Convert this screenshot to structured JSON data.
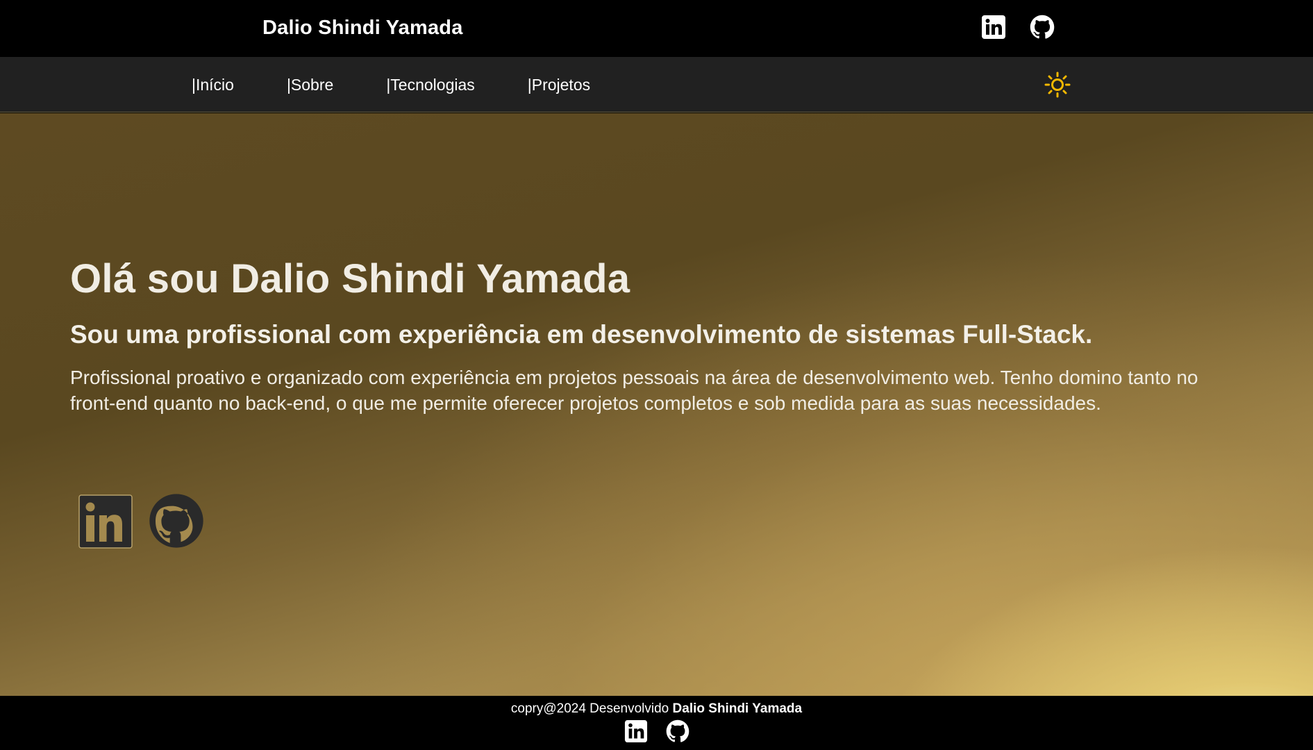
{
  "header": {
    "brand": "Dalio Shindi Yamada",
    "icons": [
      "linkedin-icon",
      "github-icon"
    ]
  },
  "nav": {
    "items": [
      {
        "label": "|Início"
      },
      {
        "label": "|Sobre"
      },
      {
        "label": "|Tecnologias"
      },
      {
        "label": "|Projetos"
      }
    ],
    "theme_icon": "sun-icon",
    "theme_icon_color": "#f5b800"
  },
  "hero": {
    "title": "Olá sou Dalio Shindi Yamada",
    "subtitle": "Sou uma profissional com experiência em desenvolvimento de sistemas Full-Stack.",
    "description": "Profissional proativo e organizado com experiência em projetos pessoais na área de desenvolvimento web. Tenho domino tanto no front-end quanto no back-end, o que me permite oferecer projetos completos e sob medida para as suas necessidades.",
    "social_icons": [
      "linkedin-icon",
      "github-icon"
    ]
  },
  "footer": {
    "prefix": "copry@2024 Desenvolvido",
    "author": "Dalio Shindi Yamada",
    "icons": [
      "linkedin-icon",
      "github-icon"
    ]
  },
  "colors": {
    "background": "#000000",
    "navbar": "#212121",
    "hero_gradient_start": "#5e4a22",
    "hero_gradient_end": "#fffcb4"
  }
}
